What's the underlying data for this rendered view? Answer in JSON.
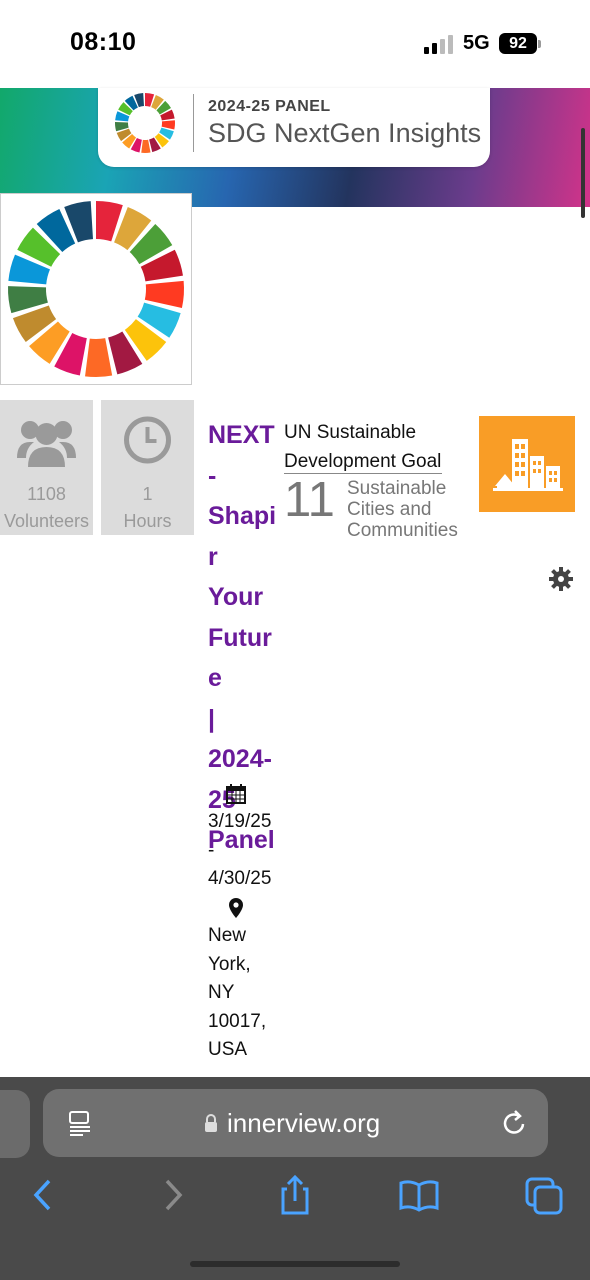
{
  "status": {
    "time": "08:10",
    "network": "5G",
    "battery": "92"
  },
  "banner": {
    "panel_label": "2024-25 PANEL",
    "brand": "SDG NextGen Insights"
  },
  "stats": [
    {
      "value": "1108",
      "label": "Volunteers",
      "icon": "people-icon"
    },
    {
      "value": "1",
      "label": "Hours",
      "icon": "clock-icon"
    }
  ],
  "event": {
    "title": "NEXT - Shaping Your Future | 2024-25 Panel",
    "title_lines": [
      "NEXT",
      "-",
      "Shapir",
      "Your",
      "Future",
      "|",
      "2024-",
      "25",
      "Panel"
    ],
    "date_lines": [
      "3/19/25",
      "-",
      "4/30/25"
    ],
    "location_lines": [
      "New",
      "York,",
      "NY",
      "10017,",
      "USA"
    ]
  },
  "goal": {
    "heading_line1": "UN Sustainable",
    "heading_line2": "Development Goal",
    "number": "11",
    "name_lines": [
      "Sustainable",
      "Cities and",
      "Communities"
    ],
    "tile_color": "#f99d26"
  },
  "browser": {
    "url": "innerview.org"
  },
  "colors": {
    "accent_purple": "#6a1b9a",
    "ios_blue": "#4aa3ff",
    "stat_bg": "#dcdcdc"
  }
}
